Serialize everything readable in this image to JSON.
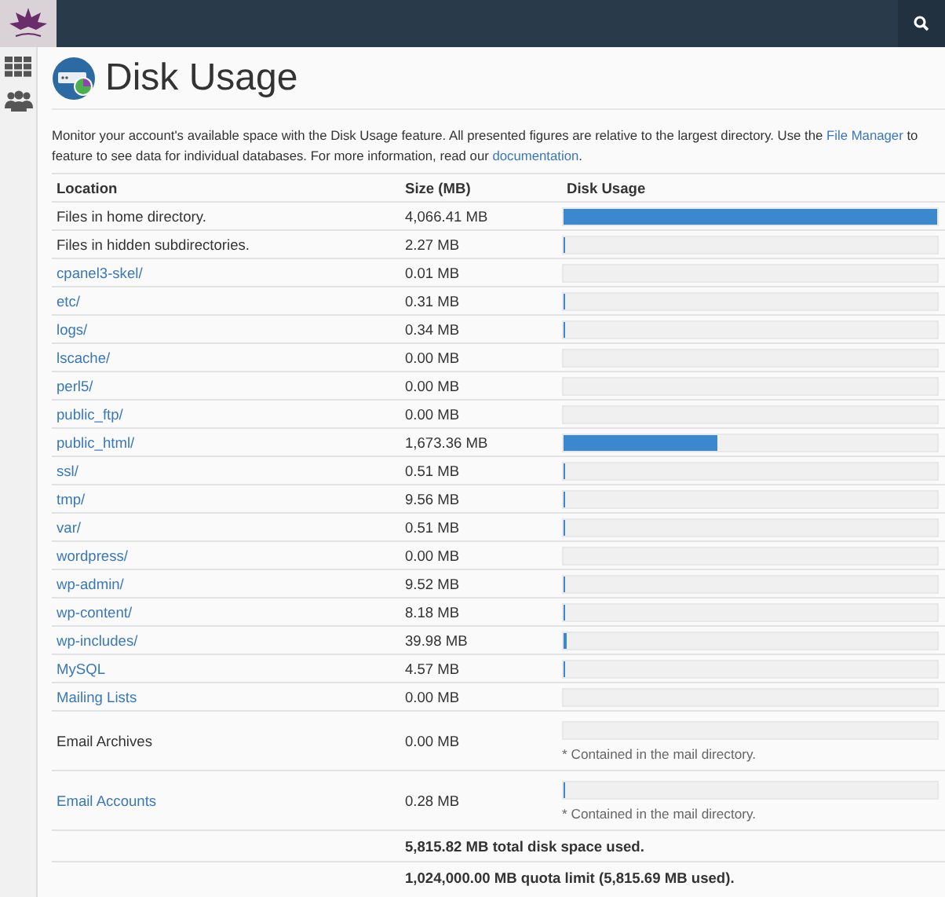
{
  "page": {
    "title": "Disk Usage",
    "intro": [
      [
        {
          "text": "Monitor your account's available space with the Disk Usage feature. All presented figures are relative to the largest directory. Use the ",
          "link": false
        },
        {
          "text": "File Manager",
          "link": true
        },
        {
          "text": " to",
          "link": false
        }
      ],
      [
        {
          "text": "feature to see data for individual databases. For more information, read our ",
          "link": false
        },
        {
          "text": "documentation",
          "link": true
        },
        {
          "text": ".",
          "link": false
        }
      ]
    ]
  },
  "table": {
    "columns": [
      "Location",
      "Size (MB)",
      "Disk Usage"
    ],
    "rows": [
      {
        "location": "Files in home directory.",
        "link": false,
        "size": "4,066.41 MB",
        "level": 1
      },
      {
        "location": "Files in hidden subdirectories.",
        "link": false,
        "size": "2.27 MB",
        "level": 0.0006
      },
      {
        "location": "cpanel3-skel/",
        "link": true,
        "size": "0.01 MB"
      },
      {
        "location": "etc/",
        "link": true,
        "size": "0.31 MB",
        "level": 0.0001
      },
      {
        "location": "logs/",
        "link": true,
        "size": "0.34 MB",
        "level": 0.0001
      },
      {
        "location": "lscache/",
        "link": true,
        "size": "0.00 MB"
      },
      {
        "location": "perl5/",
        "link": true,
        "size": "0.00 MB"
      },
      {
        "location": "public_ftp/",
        "link": true,
        "size": "0.00 MB"
      },
      {
        "location": "public_html/",
        "link": true,
        "size": "1,673.36 MB",
        "level": 0.41
      },
      {
        "location": "ssl/",
        "link": true,
        "size": "0.51 MB",
        "level": 0.0001
      },
      {
        "location": "tmp/",
        "link": true,
        "size": "9.56 MB",
        "level": 0.0024
      },
      {
        "location": "var/",
        "link": true,
        "size": "0.51 MB",
        "level": 0.0001
      },
      {
        "location": "wordpress/",
        "link": true,
        "size": "0.00 MB"
      },
      {
        "location": "wp-admin/",
        "link": true,
        "size": "9.52 MB",
        "level": 0.0023
      },
      {
        "location": "wp-content/",
        "link": true,
        "size": "8.18 MB",
        "level": 0.002
      },
      {
        "location": "wp-includes/",
        "link": true,
        "size": "39.98 MB",
        "level": 0.0098
      },
      {
        "location": "MySQL",
        "link": true,
        "size": "4.57 MB",
        "level": 0.0011
      },
      {
        "location": "Mailing Lists",
        "link": true,
        "size": "0.00 MB"
      },
      {
        "location": "Email Archives",
        "link": false,
        "size": "0.00 MB",
        "note": "* Contained in the mail directory."
      },
      {
        "location": "Email Accounts",
        "link": true,
        "size": "0.28 MB",
        "level": 0.0001,
        "note": "* Contained in the mail directory."
      }
    ],
    "totals": [
      "5,815.82 MB total disk space used.",
      "1,024,000.00 MB quota limit (5,815.69 MB used)."
    ]
  }
}
